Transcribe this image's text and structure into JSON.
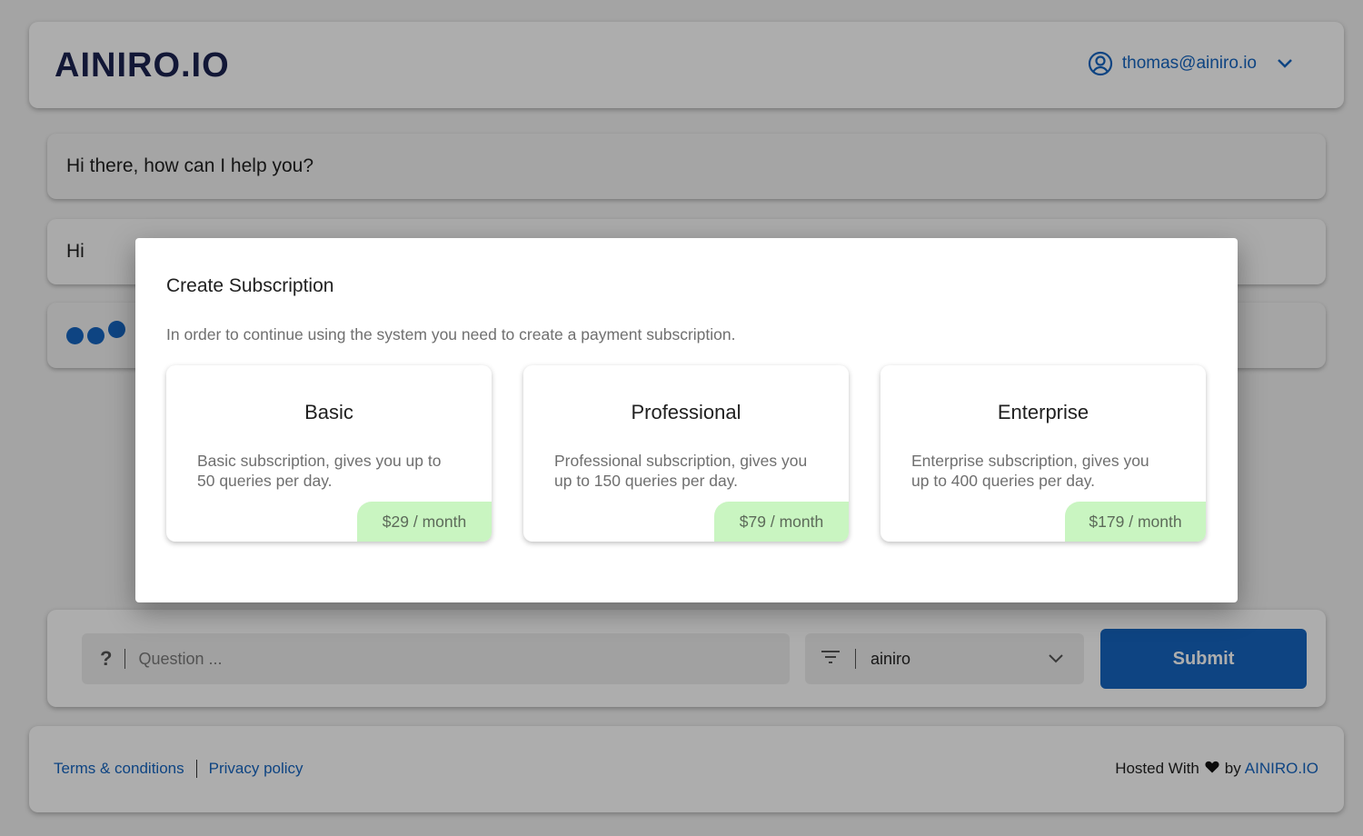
{
  "header": {
    "logo": "AINIRO.IO",
    "user_email": "thomas@ainiro.io"
  },
  "messages": [
    "Hi there, how can I help you?",
    "Hi"
  ],
  "composer": {
    "question_placeholder": "Question ...",
    "question_icon": "?",
    "model_selected": "ainiro",
    "submit_label": "Submit"
  },
  "footer": {
    "terms_label": "Terms & conditions",
    "privacy_label": "Privacy policy",
    "hosted_with": "Hosted With",
    "by": "by",
    "brand": "AINIRO.IO"
  },
  "dialog": {
    "title": "Create Subscription",
    "text": "In order to continue using the system you need to create a payment subscription.",
    "plans": [
      {
        "name": "Basic",
        "description": "Basic subscription, gives you up to 50 queries per day.",
        "price": "$29 / month"
      },
      {
        "name": "Professional",
        "description": "Professional subscription, gives you up to 150 queries per day.",
        "price": "$79 / month"
      },
      {
        "name": "Enterprise",
        "description": "Enterprise subscription, gives you up to 400 queries per day.",
        "price": "$179 / month"
      }
    ]
  },
  "colors": {
    "accent": "#1565c0",
    "price_badge": "#c9f5c1",
    "logo": "#1b2250"
  }
}
